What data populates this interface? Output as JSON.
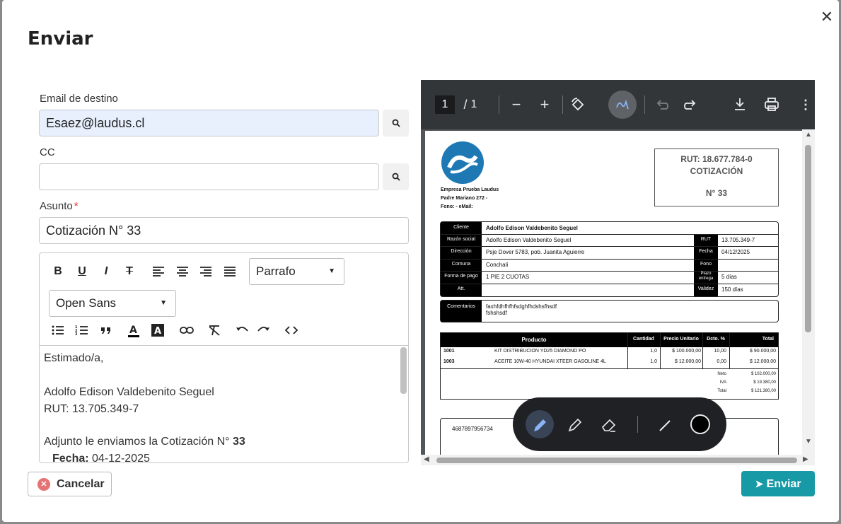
{
  "dialog": {
    "title": "Enviar",
    "close_icon": "✕"
  },
  "form": {
    "email_label": "Email de destino",
    "email_value": "Esaez@laudus.cl",
    "cc_label": "CC",
    "cc_value": "",
    "subject_label": "Asunto",
    "subject_required": "*",
    "subject_value": "Cotización N° 33"
  },
  "editor": {
    "toolbar": {
      "bold": "B",
      "underline": "U",
      "italic": "I",
      "strike": "T",
      "paragraph": "Parrafo",
      "font": "Open Sans"
    },
    "body": {
      "greeting": "Estimado/a,",
      "name": "Adolfo Edison Valdebenito Seguel",
      "rut": "RUT: 13.705.349-7",
      "attach_text": "Adjunto le enviamos la Cotización N° ",
      "attach_num": "33",
      "date_label": "Fecha:",
      "date_value": " 04-12-2025"
    }
  },
  "viewer": {
    "page_current": "1",
    "page_sep": "/",
    "page_total": "1",
    "doc": {
      "company": "Empresa Prueba Laudus",
      "address": "Padre Mariano 272   -",
      "contact": "Fono:    -   eMail:",
      "rut": "RUT: 18.677.784-0",
      "doc_type": "COTIZACIÓN",
      "doc_number": "N°   33",
      "fields": {
        "cliente_l": "Cliente",
        "cliente": "Adolfo Edison Valdebenito Seguel",
        "razon_l": "Razón social",
        "razon": "Adolfo Edison Valdebenito Seguel",
        "rut_l": "RUT",
        "rut": "13.705.349-7",
        "dir_l": "Dirección",
        "dir": "Psje Dover 5783, pob. Juanita Aguierre",
        "fecha_l": "Fecha",
        "fecha": "04/12/2025",
        "comuna_l": "Comuna",
        "comuna": "Conchali",
        "fono_l": "Fono",
        "fono": "",
        "pago_l": "Forma de pago",
        "pago": "1 PIE 2 CUOTAS",
        "plazo_l": "Plazo entrega",
        "plazo": "5 días",
        "att_l": "Att.",
        "att": "",
        "validez_l": "Validez",
        "validez": "150 días"
      },
      "comments_l": "Comentarios",
      "comments_1": "faxhfdhfhfhfsdghfhdshsfhsdf",
      "comments_2": "fshshsdf",
      "table": {
        "headers": [
          "Producto",
          "Cantidad",
          "Precio Unitario",
          "Dcto. %",
          "Total"
        ],
        "rows": [
          {
            "code": "1001",
            "desc": "KIT DISTRIBUCION YD25 DIAMOND PO",
            "qty": "1,0",
            "price": "$ 100.000,00",
            "disc": "10,00",
            "total": "$ 90.000,00"
          },
          {
            "code": "1003",
            "desc": "ACEITE 10W-40 HYUNDAI XTEER GASOLINE 4L",
            "qty": "1,0",
            "price": "$ 12.000,00",
            "disc": "0,00",
            "total": "$ 12.000,00"
          }
        ],
        "neto_l": "Neto",
        "neto": "$ 102.000,00",
        "iva_l": "IVA",
        "iva": "$ 19.380,00",
        "total_l": "Total",
        "total": "$ 121.380,00"
      },
      "footer_num": "4687897956734"
    }
  },
  "actions": {
    "cancel": "Cancelar",
    "send": "Enviar"
  },
  "colors": {
    "send": "#179aa5",
    "cancel_icon": "#e57373",
    "email_bg": "#e8f0fe",
    "annot_active": "#8ab4f8"
  }
}
